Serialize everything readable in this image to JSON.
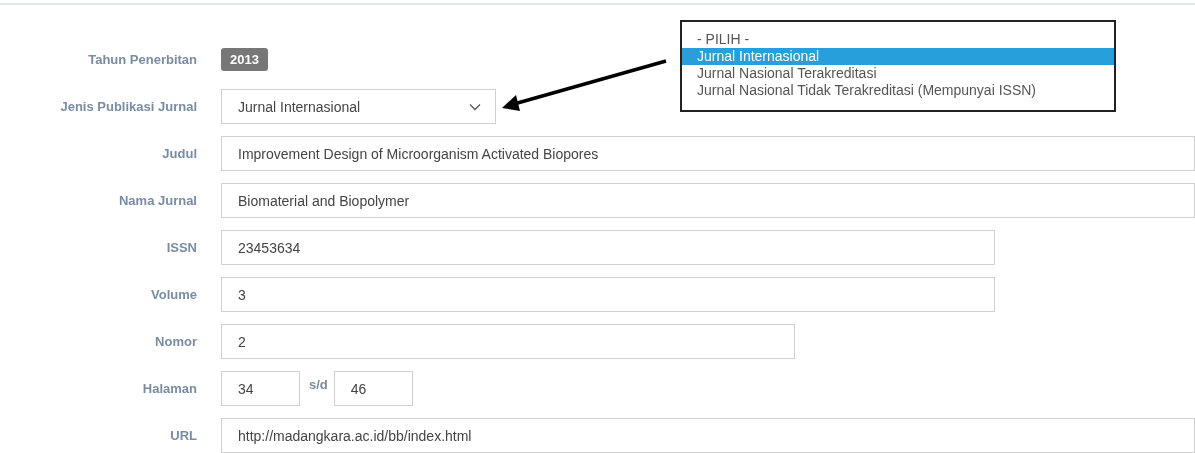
{
  "fields": [
    {
      "label": "Tahun Penerbitan",
      "kind": "badge",
      "value": "2013"
    },
    {
      "label": "Jenis Publikasi Jurnal",
      "kind": "select",
      "value": "Jurnal Internasional"
    },
    {
      "label": "Judul",
      "kind": "text",
      "value": "Improvement Design of Microorganism Activated Biopores"
    },
    {
      "label": "Nama Jurnal",
      "kind": "text",
      "value": "Biomaterial and Biopolymer"
    },
    {
      "label": "ISSN",
      "kind": "text",
      "value": "23453634"
    },
    {
      "label": "Volume",
      "kind": "text",
      "value": "3"
    },
    {
      "label": "Nomor",
      "kind": "text",
      "value": "2"
    },
    {
      "label": "Halaman",
      "kind": "range",
      "from": "34",
      "separator": "s/d",
      "to": "46"
    },
    {
      "label": "URL",
      "kind": "text",
      "value": "http://madangkara.ac.id/bb/index.html"
    }
  ],
  "dropdown": {
    "options": [
      {
        "label": "- PILIH -",
        "selected": false
      },
      {
        "label": "Jurnal Internasional",
        "selected": true
      },
      {
        "label": "Jurnal Nasional Terakreditasi",
        "selected": false
      },
      {
        "label": "Jurnal Nasional Tidak Terakreditasi (Mempunyai ISSN)",
        "selected": false
      }
    ]
  }
}
